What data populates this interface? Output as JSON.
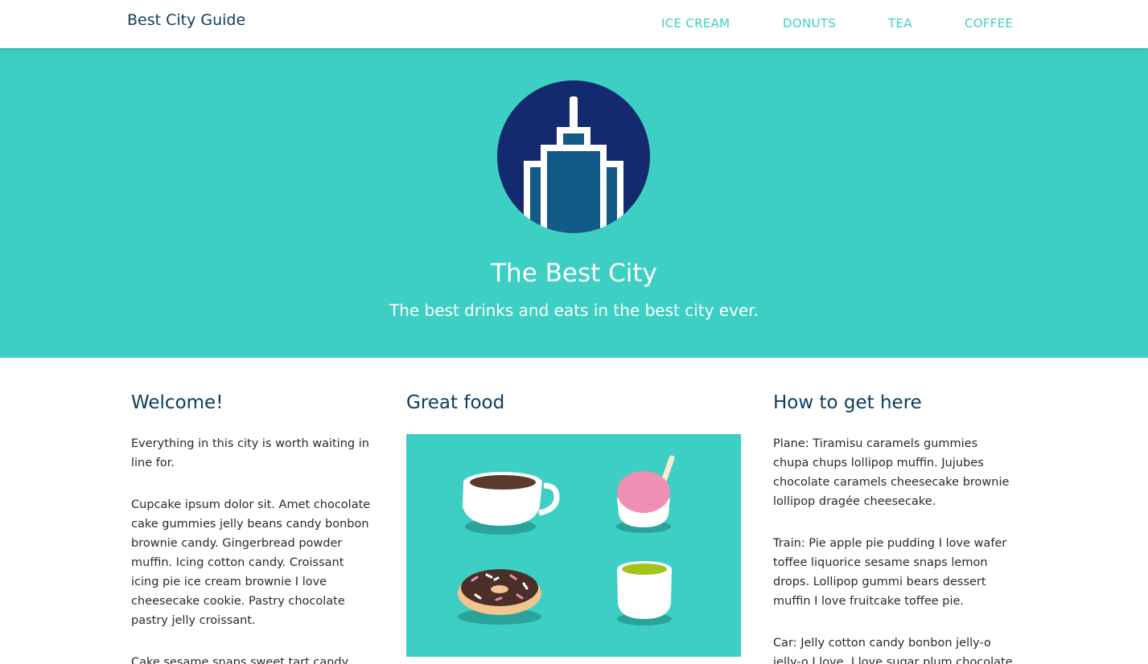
{
  "nav": {
    "brand": "Best City Guide",
    "links": [
      "ICE CREAM",
      "DONUTS",
      "TEA",
      "COFFEE"
    ]
  },
  "hero": {
    "logo_icon": "city-skyline-icon",
    "title": "The Best City",
    "subtitle": "The best drinks and eats in the best city ever."
  },
  "welcome": {
    "heading": "Welcome!",
    "paragraphs": [
      "Everything in this city is worth waiting in line for.",
      "Cupcake ipsum dolor sit. Amet chocolate cake gummies jelly beans candy bonbon brownie candy. Gingerbread powder muffin. Icing cotton candy. Croissant icing pie ice cream brownie I love cheesecake cookie. Pastry chocolate pastry jelly croissant.",
      "Cake sesame snaps sweet tart candy"
    ]
  },
  "food": {
    "heading": "Great food",
    "image_icon": "food-illustration"
  },
  "travel": {
    "heading": "How to get here",
    "paragraphs": [
      "Plane: Tiramisu caramels gummies chupa chups lollipop muffin. Jujubes chocolate caramels cheesecake brownie lollipop dragée cheesecake.",
      "Train: Pie apple pie pudding I love wafer toffee liquorice sesame snaps lemon drops. Lollipop gummi bears dessert muffin I love fruitcake toffee pie.",
      "Car: Jelly cotton candy bonbon jelly-o jelly-o I love. I love sugar plum chocolate"
    ]
  },
  "colors": {
    "teal": "#3ecfc4",
    "navy": "#0d3d5c",
    "logo_circle": "#132a6e"
  }
}
